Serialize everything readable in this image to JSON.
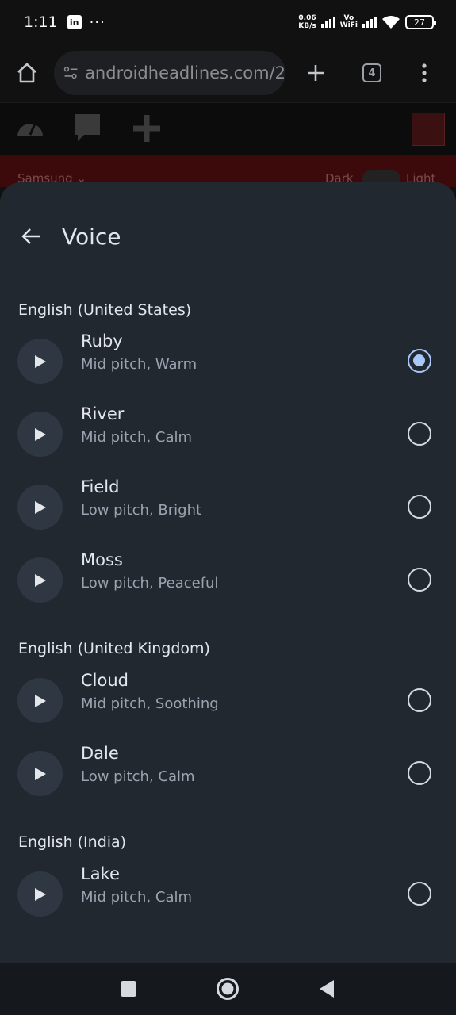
{
  "status_bar": {
    "time": "1:11",
    "notification_badge": "in",
    "more": "···",
    "netspeed_value": "0.06",
    "netspeed_unit": "KB/s",
    "vowifi_top": "Vo",
    "vowifi_bottom": "WiFi",
    "battery": "27"
  },
  "browser": {
    "url": "androidheadlines.com/2",
    "tab_count": "4"
  },
  "page": {
    "site_label": "Samsung ⌄",
    "dark_label": "Dark",
    "light_label": "Light"
  },
  "sheet": {
    "title": "Voice",
    "sections": [
      {
        "label": "English (United States)"
      },
      {
        "label": "English (United Kingdom)"
      },
      {
        "label": "English (India)"
      }
    ],
    "voices": [
      {
        "name": "Ruby",
        "desc": "Mid pitch, Warm",
        "selected": true
      },
      {
        "name": "River",
        "desc": "Mid pitch, Calm",
        "selected": false
      },
      {
        "name": "Field",
        "desc": "Low pitch, Bright",
        "selected": false
      },
      {
        "name": "Moss",
        "desc": "Low pitch, Peaceful",
        "selected": false
      },
      {
        "name": "Cloud",
        "desc": "Mid pitch, Soothing",
        "selected": false
      },
      {
        "name": "Dale",
        "desc": "Low pitch, Calm",
        "selected": false
      },
      {
        "name": "Lake",
        "desc": "Mid pitch, Calm",
        "selected": false
      }
    ]
  },
  "colors": {
    "sheet_bg": "#212830",
    "accent": "#a8c7fa",
    "page_strip": "#3c0a0a"
  }
}
